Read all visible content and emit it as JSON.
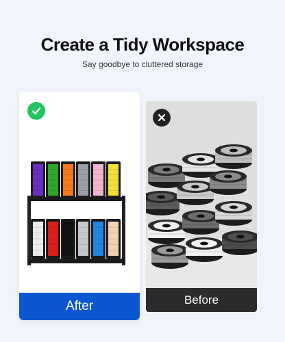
{
  "header": {
    "title": "Create a Tidy Workspace",
    "subtitle": "Say goodbye to cluttered storage"
  },
  "after": {
    "label": "After",
    "label_bg": "#0b57d0",
    "badge_icon": "check-circle-icon",
    "badge_color": "#22c55e",
    "top_shelf_colors": [
      "#6a2fc2",
      "#2fa52b",
      "#f57a1c",
      "#9a9ea6",
      "#f1b6cf",
      "#f4e03a"
    ],
    "bottom_shelf_colors": [
      "#ececec",
      "#d81e1e",
      "#111111",
      "#c5c8cc",
      "#1e88e5",
      "#f3d1b5"
    ]
  },
  "before": {
    "label": "Before",
    "label_bg": "#2b2b2b",
    "badge_icon": "x-circle-icon",
    "badge_color": "#222222"
  }
}
